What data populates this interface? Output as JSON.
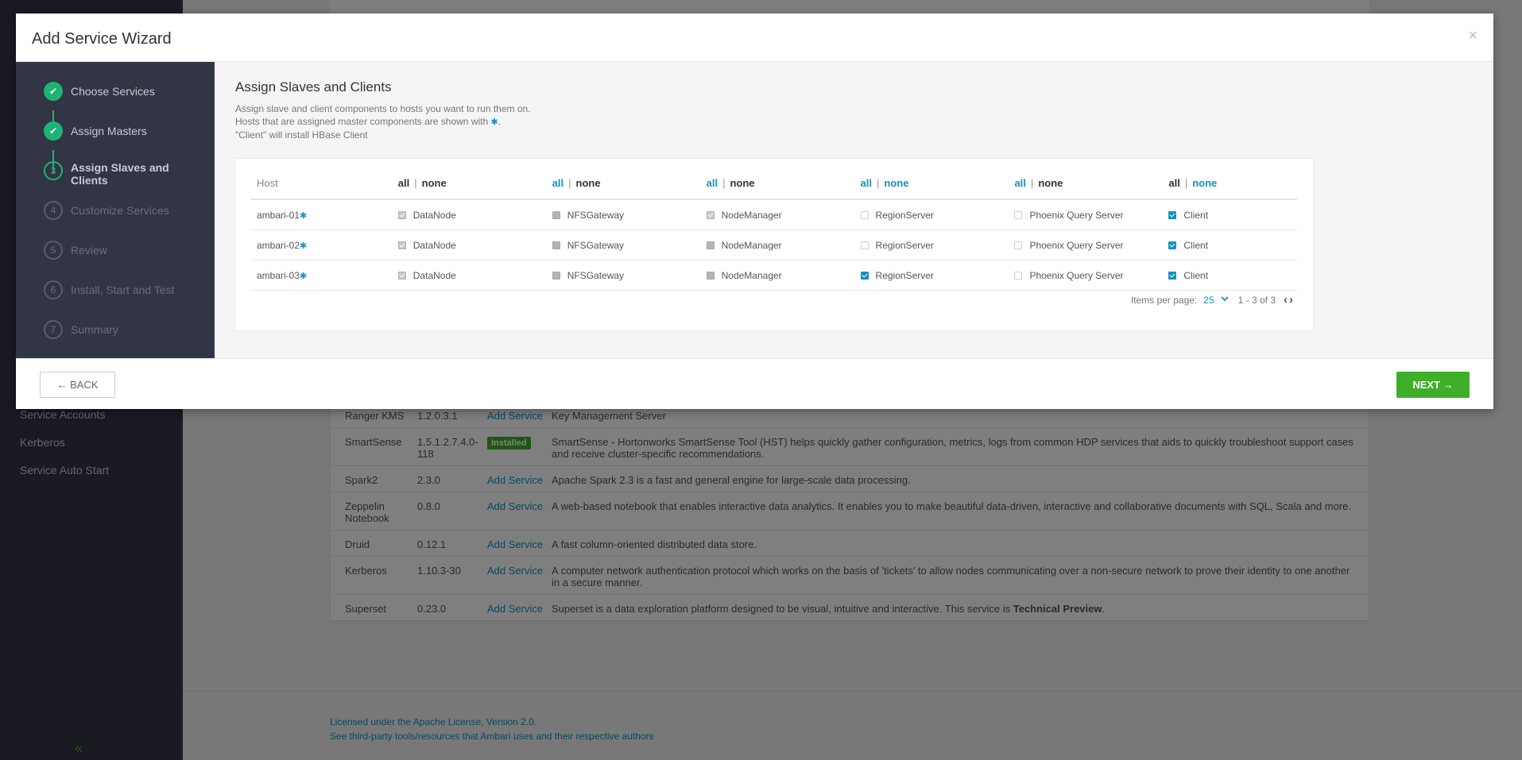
{
  "background": {
    "sidebar_items": [
      "Service Accounts",
      "Kerberos",
      "Service Auto Start"
    ],
    "services": [
      {
        "name": "Ranger KMS",
        "version": "1.2.0.3.1",
        "action": "Add Service",
        "installed": false,
        "description": "Key Management Server"
      },
      {
        "name": "SmartSense",
        "version": "1.5.1.2.7.4.0-118",
        "action": "Installed",
        "installed": true,
        "description": "SmartSense - Hortonworks SmartSense Tool (HST) helps quickly gather configuration, metrics, logs from common HDP services that aids to quickly troubleshoot support cases and receive cluster-specific recommendations."
      },
      {
        "name": "Spark2",
        "version": "2.3.0",
        "action": "Add Service",
        "installed": false,
        "description": "Apache Spark 2.3 is a fast and general engine for large-scale data processing."
      },
      {
        "name": "Zeppelin Notebook",
        "version": "0.8.0",
        "action": "Add Service",
        "installed": false,
        "description": "A web-based notebook that enables interactive data analytics. It enables you to make beautiful data-driven, interactive and collaborative documents with SQL, Scala and more."
      },
      {
        "name": "Druid",
        "version": "0.12.1",
        "action": "Add Service",
        "installed": false,
        "description": "A fast column-oriented distributed data store."
      },
      {
        "name": "Kerberos",
        "version": "1.10.3-30",
        "action": "Add Service",
        "installed": false,
        "description": "A computer network authentication protocol which works on the basis of 'tickets' to allow nodes communicating over a non-secure network to prove their identity to one another in a secure manner."
      },
      {
        "name": "Superset",
        "version": "0.23.0",
        "action": "Add Service",
        "installed": false,
        "description": "Superset is a data exploration platform designed to be visual, intuitive and interactive. This service is ",
        "description_bold": "Technical Preview",
        "description_end": "."
      }
    ],
    "footer_links": [
      "Licensed under the Apache License, Version 2.0.",
      "See third-party tools/resources that Ambari uses and their respective authors"
    ],
    "collapse_glyph": "«"
  },
  "modal": {
    "title": "Add Service Wizard",
    "close_glyph": "×",
    "steps": [
      {
        "num": "✔",
        "label": "Choose Services",
        "state": "done"
      },
      {
        "num": "✔",
        "label": "Assign Masters",
        "state": "done"
      },
      {
        "num": "3",
        "label": "Assign Slaves and Clients",
        "state": "current"
      },
      {
        "num": "4",
        "label": "Customize Services",
        "state": "todo"
      },
      {
        "num": "5",
        "label": "Review",
        "state": "todo"
      },
      {
        "num": "6",
        "label": "Install, Start and Test",
        "state": "todo"
      },
      {
        "num": "7",
        "label": "Summary",
        "state": "todo"
      }
    ],
    "content": {
      "title": "Assign Slaves and Clients",
      "desc_line1": "Assign slave and client components to hosts you want to run them on.",
      "desc_line2": "Hosts that are assigned master components are shown with",
      "desc_line2_end": ".",
      "desc_line3": "\"Client\" will install HBase Client",
      "star_glyph": "✱"
    },
    "grid": {
      "host_header": "Host",
      "all_label": "all",
      "none_label": "none",
      "column_selectors": [
        {
          "all": "active",
          "none": "active"
        },
        {
          "all": "link",
          "none": "active"
        },
        {
          "all": "link",
          "none": "active"
        },
        {
          "all": "link",
          "none": "link"
        },
        {
          "all": "link",
          "none": "active"
        },
        {
          "all": "active",
          "none": "link"
        }
      ],
      "rows": [
        {
          "host": "ambari-01",
          "cells": [
            {
              "label": "DataNode",
              "state": "checked-disabled"
            },
            {
              "label": "NFSGateway",
              "state": "solid-disabled"
            },
            {
              "label": "NodeManager",
              "state": "checked-disabled"
            },
            {
              "label": "RegionServer",
              "state": "empty"
            },
            {
              "label": "Phoenix Query Server",
              "state": "empty"
            },
            {
              "label": "Client",
              "state": "checked"
            }
          ]
        },
        {
          "host": "ambari-02",
          "cells": [
            {
              "label": "DataNode",
              "state": "checked-disabled"
            },
            {
              "label": "NFSGateway",
              "state": "solid-disabled"
            },
            {
              "label": "NodeManager",
              "state": "solid-disabled"
            },
            {
              "label": "RegionServer",
              "state": "empty"
            },
            {
              "label": "Phoenix Query Server",
              "state": "empty"
            },
            {
              "label": "Client",
              "state": "checked"
            }
          ]
        },
        {
          "host": "ambari-03",
          "cells": [
            {
              "label": "DataNode",
              "state": "checked-disabled"
            },
            {
              "label": "NFSGateway",
              "state": "solid-disabled"
            },
            {
              "label": "NodeManager",
              "state": "solid-disabled"
            },
            {
              "label": "RegionServer",
              "state": "checked"
            },
            {
              "label": "Phoenix Query Server",
              "state": "empty"
            },
            {
              "label": "Client",
              "state": "checked"
            }
          ]
        }
      ]
    },
    "pager": {
      "label": "Items per page:",
      "value": "25",
      "range": "1 - 3 of 3",
      "prev_glyph": "‹",
      "next_glyph": "›"
    },
    "footer": {
      "back_label": "← BACK",
      "next_label": "NEXT →"
    },
    "colors": {
      "sidebar": "#323544",
      "step_done": "#1eb475",
      "accent": "#1491c1",
      "next_button": "#3fae2a"
    }
  }
}
